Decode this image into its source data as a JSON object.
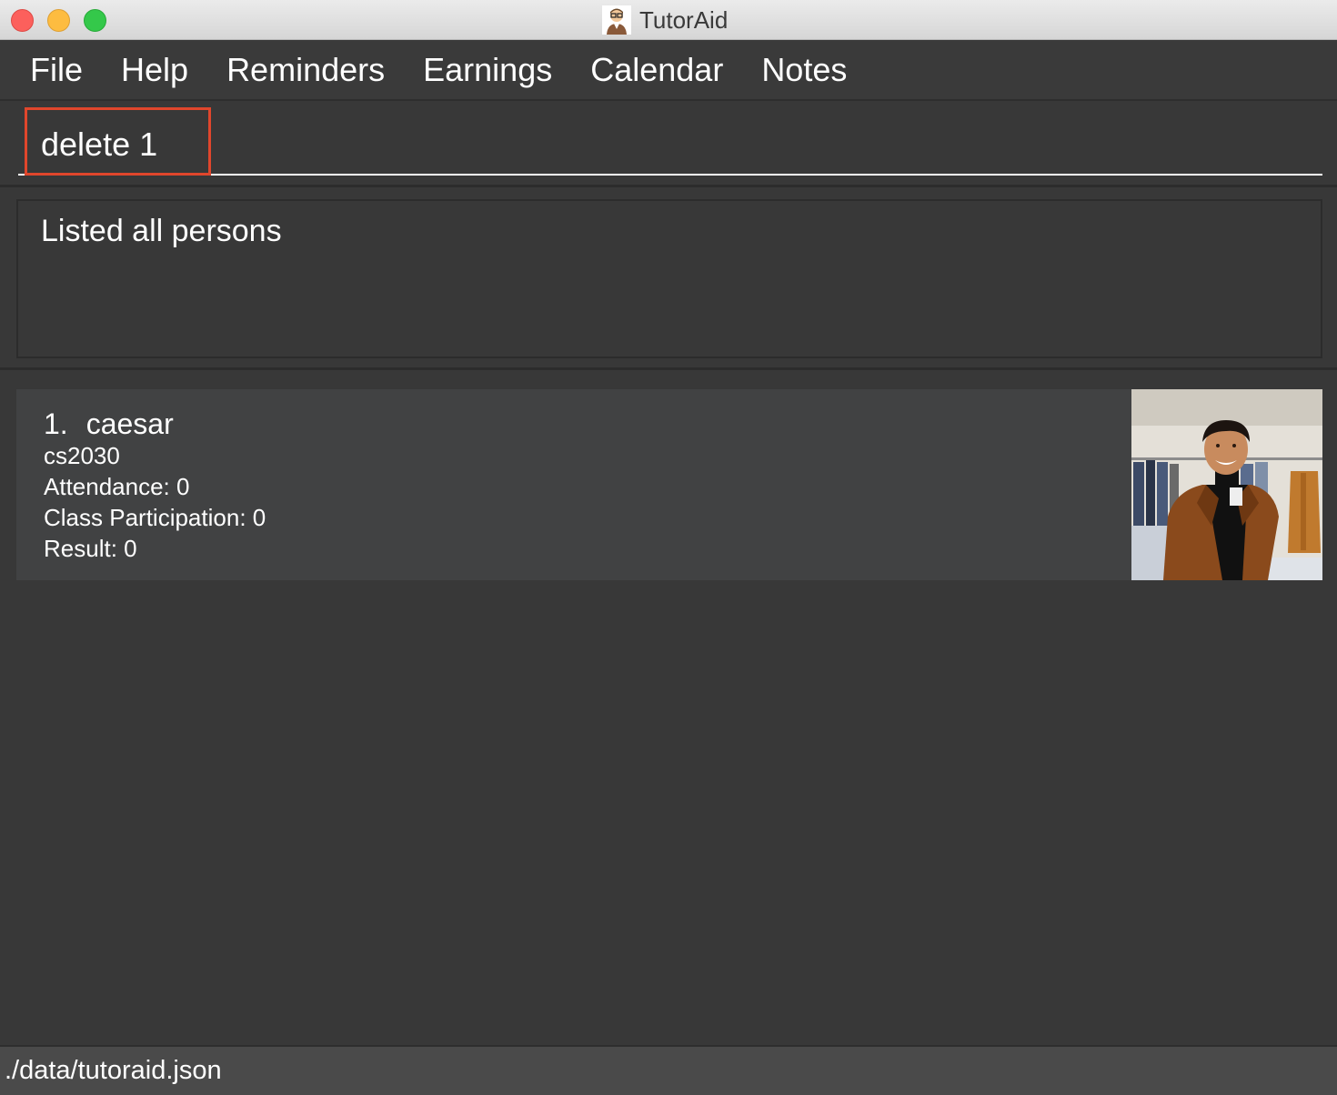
{
  "window": {
    "title": "TutorAid",
    "app_icon": "tutor-avatar-icon"
  },
  "menu": {
    "items": [
      {
        "label": "File"
      },
      {
        "label": "Help"
      },
      {
        "label": "Reminders"
      },
      {
        "label": "Earnings"
      },
      {
        "label": "Calendar"
      },
      {
        "label": "Notes"
      }
    ]
  },
  "command": {
    "value": "delete 1",
    "highlight_color": "#e0462c"
  },
  "result": {
    "message": "Listed all persons"
  },
  "persons": [
    {
      "index": "1.",
      "name": "caesar",
      "module": "cs2030",
      "attendance": "Attendance: 0",
      "participation": "Class Participation: 0",
      "result": "Result: 0"
    }
  ],
  "status": {
    "path": "./data/tutoraid.json"
  },
  "colors": {
    "background": "#383838",
    "card": "#414243",
    "statusbar": "#4a4a4a"
  }
}
